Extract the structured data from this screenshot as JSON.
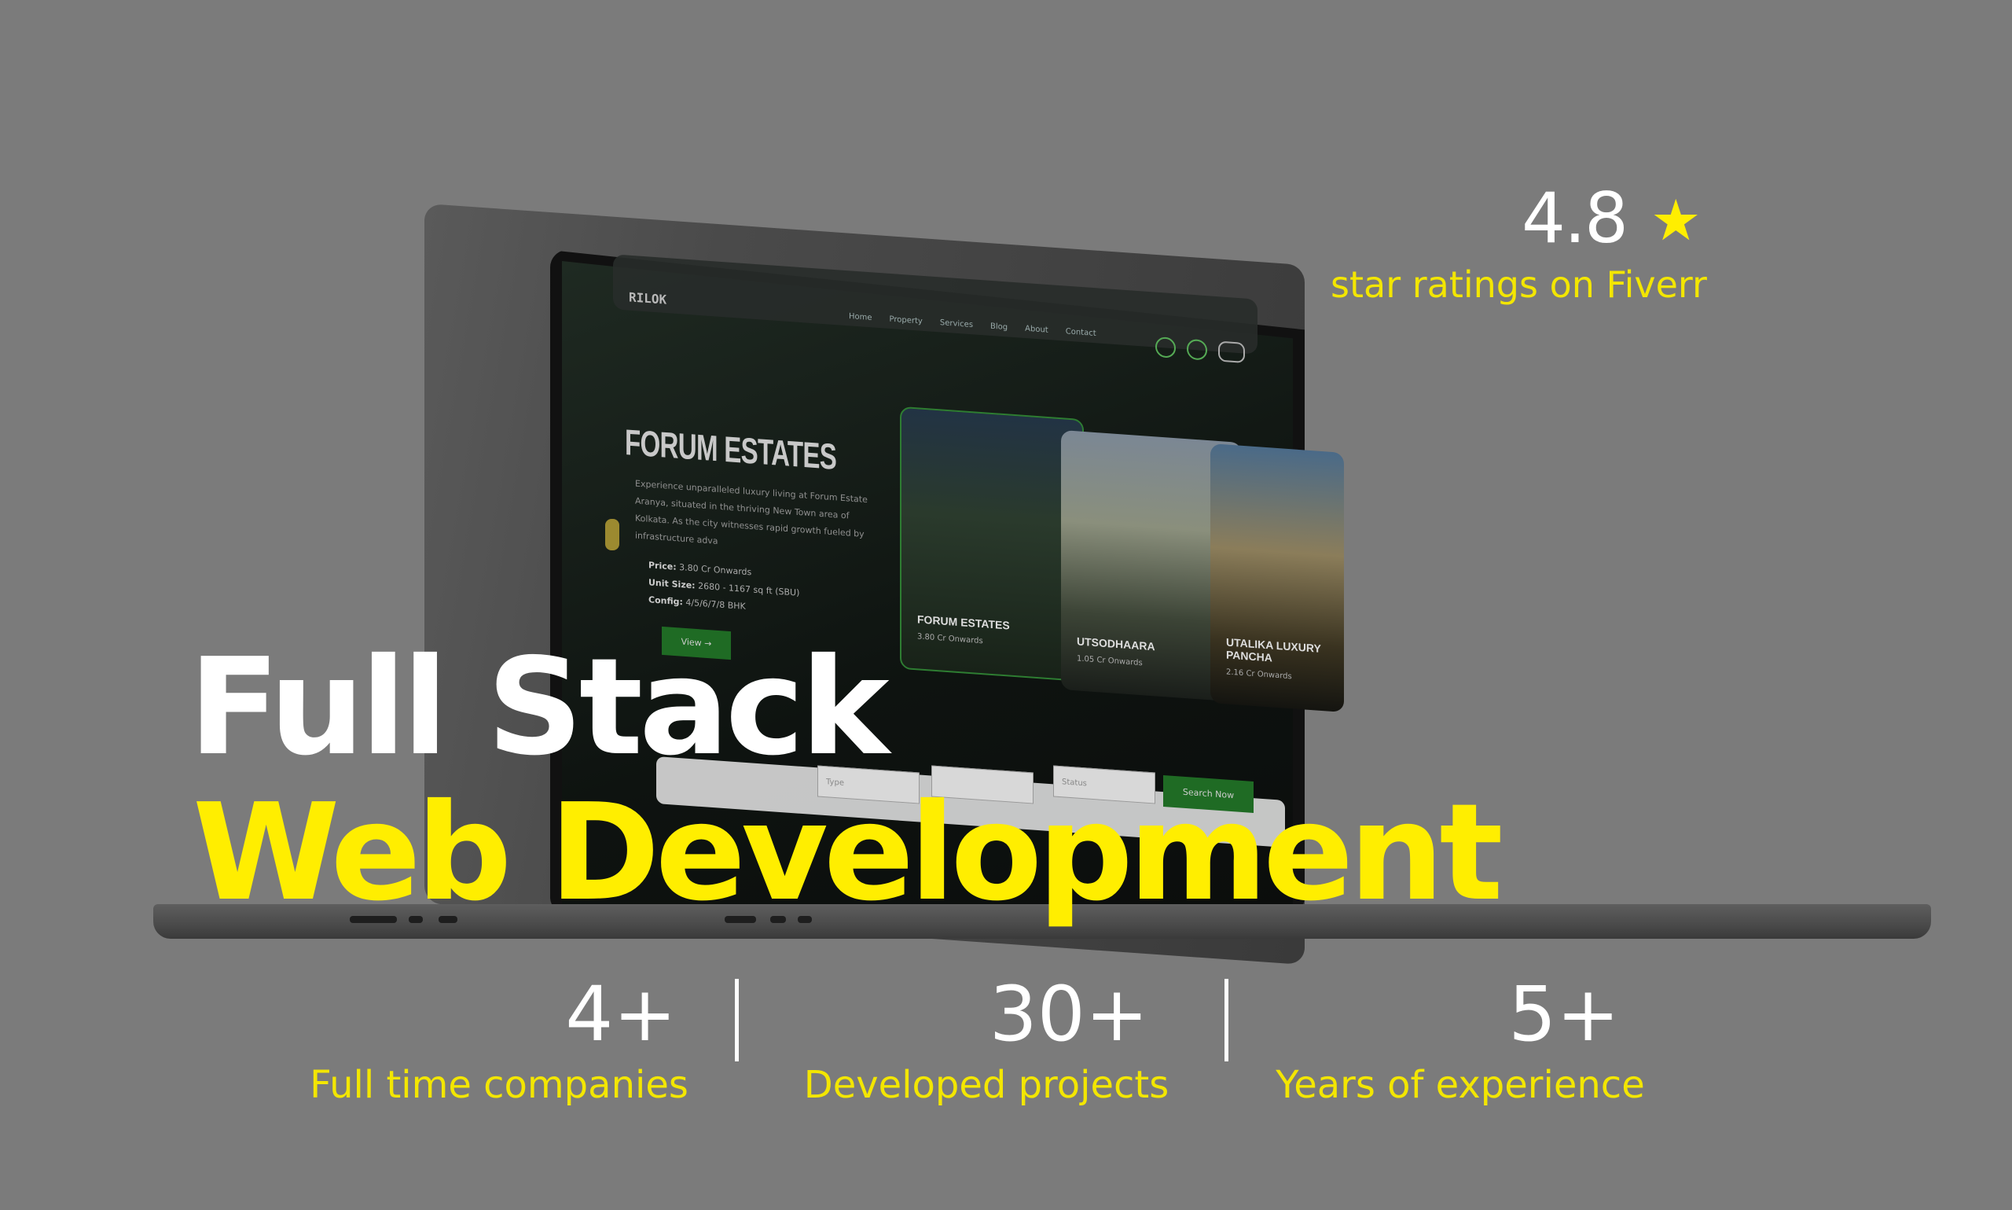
{
  "rating": {
    "value": "4.8",
    "star_icon": "star-icon",
    "label": "star ratings on Fiverr"
  },
  "hero": {
    "line1": "Full Stack",
    "line2": "Web Development"
  },
  "stats": [
    {
      "value": "4+",
      "label": "Full time companies"
    },
    {
      "value": "30+",
      "label": "Developed  projects"
    },
    {
      "value": "5+",
      "label": "Years of experience"
    }
  ],
  "colors": {
    "background": "#7b7b7b",
    "accent_yellow": "#ffee00",
    "text_white": "#ffffff",
    "screen_green": "#1f6b24"
  },
  "laptop_screen": {
    "logo": "RILOK",
    "menu": [
      "Home",
      "Property",
      "Services",
      "Blog",
      "About",
      "Contact"
    ],
    "heading": "FORUM ESTATES",
    "paragraph": "Experience unparalleled luxury living at Forum Estate Aranya, situated in the thriving New Town area of Kolkata. As the city witnesses rapid growth fueled by infrastructure adva",
    "details": [
      {
        "label": "Price:",
        "value": "3.80 Cr Onwards"
      },
      {
        "label": "Unit Size:",
        "value": "2680 - 1167 sq ft (SBU)"
      },
      {
        "label": "Config:",
        "value": "4/5/6/7/8 BHK"
      }
    ],
    "view_button": "View →",
    "cards": [
      {
        "title": "FORUM ESTATES",
        "sub": "3.80 Cr Onwards"
      },
      {
        "title": "UTSODHAARA",
        "sub": "1.05 Cr Onwards"
      },
      {
        "title": "UTALIKA LUXURY PANCHA",
        "sub": "2.16 Cr Onwards"
      }
    ],
    "search": {
      "field1": "Type",
      "field2": "",
      "field3": "Status",
      "button": "Search Now"
    }
  }
}
